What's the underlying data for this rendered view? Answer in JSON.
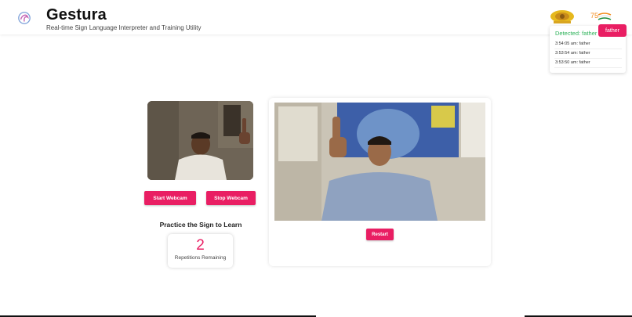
{
  "header": {
    "title": "Gestura",
    "subtitle": "Real-time Sign Language Interpreter and Training Utility"
  },
  "detection": {
    "label": "Detected: father",
    "current": "father",
    "history": [
      "3:54:05 am: father",
      "3:53:54 am: father",
      "3:53:50 am: father"
    ]
  },
  "controls": {
    "start_label": "Start Webcam",
    "stop_label": "Stop Webcam",
    "restart_label": "Restart"
  },
  "practice": {
    "heading": "Practice the Sign to Learn",
    "repetitions": "2",
    "repetitions_label": "Repetitions Remaining"
  },
  "colors": {
    "accent": "#e91e63",
    "detected": "#2eb35a"
  },
  "icons": {
    "logo": "gestura-logo-icon",
    "emblem": "state-emblem-icon",
    "azadi": "azadi-ka-amrit-mahotsav-logo"
  }
}
